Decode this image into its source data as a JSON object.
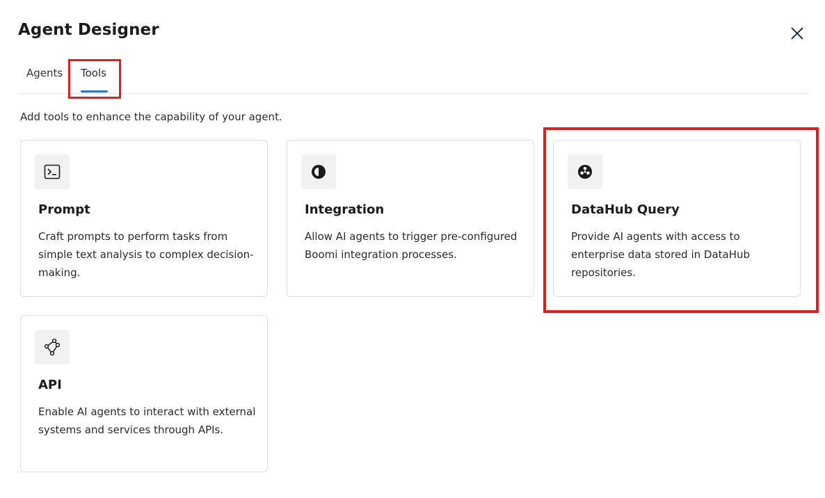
{
  "header": {
    "title": "Agent Designer"
  },
  "tabs": [
    {
      "label": "Agents",
      "active": false
    },
    {
      "label": "Tools",
      "active": true
    }
  ],
  "subtitle": "Add tools to enhance the capability of your agent.",
  "cards": [
    {
      "icon": "terminal-icon",
      "title": "Prompt",
      "description": "Craft prompts to perform tasks from simple text analysis to complex decision-making."
    },
    {
      "icon": "contrast-circle-icon",
      "title": "Integration",
      "description": "Allow AI agents to trigger pre-configured Boomi integration processes."
    },
    {
      "icon": "datahub-icon",
      "title": "DataHub Query",
      "description": "Provide AI agents with access to enterprise data stored in DataHub repositories."
    },
    {
      "icon": "api-nodes-icon",
      "title": "API",
      "description": "Enable AI agents to interact with external systems and services through APIs."
    }
  ],
  "colors": {
    "accent": "#2f6fd6",
    "highlight": "#e01e1e",
    "card_border": "#dedede",
    "icon_bg": "#f1f1f1"
  }
}
